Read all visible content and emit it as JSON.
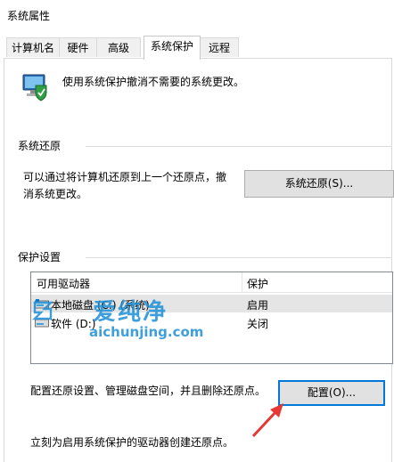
{
  "window": {
    "title": "系统属性"
  },
  "tabs": [
    {
      "label": "计算机名"
    },
    {
      "label": "硬件"
    },
    {
      "label": "高级"
    },
    {
      "label": "系统保护"
    },
    {
      "label": "远程"
    }
  ],
  "intro": {
    "text": "使用系统保护撤消不需要的系统更改。"
  },
  "restore": {
    "group_title": "系统还原",
    "description": "可以通过将计算机还原到上一个还原点，撤消系统更改。",
    "button_label": "系统还原(S)..."
  },
  "protection": {
    "group_title": "保护设置",
    "columns": [
      "可用驱动器",
      "保护"
    ],
    "drives": [
      {
        "name": "本地磁盘 (C:) (系统)",
        "status": "启用"
      },
      {
        "name": "软件 (D:)",
        "status": "关闭"
      }
    ],
    "config_text": "配置还原设置、管理磁盘空间，并且删除还原点。",
    "config_button_label": "配置(O)...",
    "create_text": "立刻为启用系统保护的驱动器创建还原点。"
  },
  "watermark": {
    "brand": "爱纯净",
    "url": "aichunjing.com",
    "color": "#1e8fd6"
  },
  "colors": {
    "focus": "#0078d7",
    "arrow": "#e53935",
    "selected_row": "#e5e5e5"
  }
}
